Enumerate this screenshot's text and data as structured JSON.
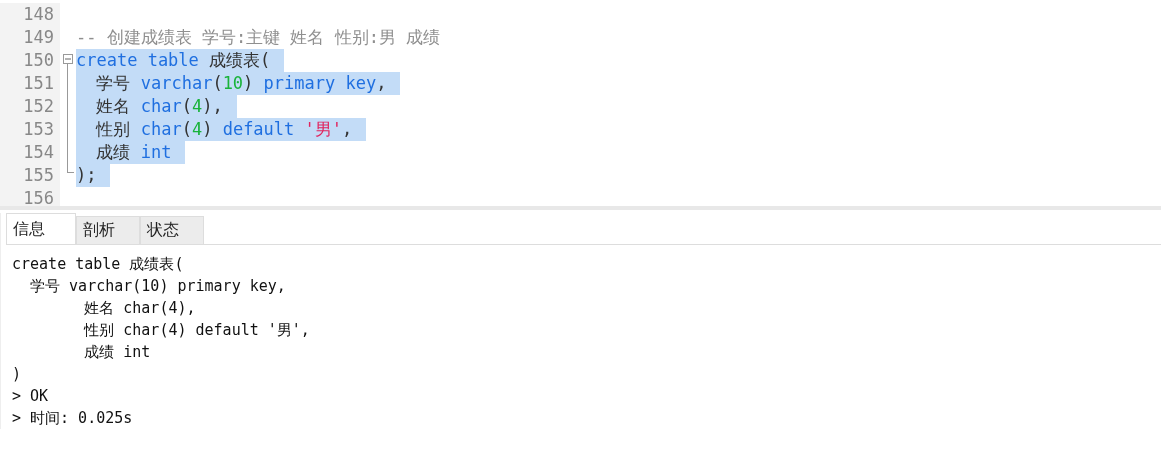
{
  "editor": {
    "lines": [
      {
        "number": "148",
        "selected": false,
        "kind": "plain"
      },
      {
        "number": "149",
        "selected": false,
        "kind": "plain",
        "tokens": [
          {
            "kind": "comment",
            "text": "-- 创建成绩表 学号:主键 姓名 性别:男 成绩"
          }
        ]
      },
      {
        "number": "150",
        "selected": true,
        "kind": "open",
        "tokens": [
          {
            "kind": "keyword",
            "text": "create table"
          },
          {
            "kind": "plain",
            "text": " 成绩表("
          }
        ]
      },
      {
        "number": "151",
        "selected": true,
        "kind": "inner",
        "tokens": [
          {
            "kind": "plain",
            "text": "  学号 "
          },
          {
            "kind": "keyword",
            "text": "varchar"
          },
          {
            "kind": "plain",
            "text": "("
          },
          {
            "kind": "number",
            "text": "10"
          },
          {
            "kind": "plain",
            "text": ") "
          },
          {
            "kind": "keyword",
            "text": "primary key"
          },
          {
            "kind": "plain",
            "text": ","
          }
        ]
      },
      {
        "number": "152",
        "selected": true,
        "kind": "inner",
        "tokens": [
          {
            "kind": "plain",
            "text": "  姓名 "
          },
          {
            "kind": "keyword",
            "text": "char"
          },
          {
            "kind": "plain",
            "text": "("
          },
          {
            "kind": "number",
            "text": "4"
          },
          {
            "kind": "plain",
            "text": "),"
          }
        ]
      },
      {
        "number": "153",
        "selected": true,
        "kind": "inner",
        "tokens": [
          {
            "kind": "plain",
            "text": "  性别 "
          },
          {
            "kind": "keyword",
            "text": "char"
          },
          {
            "kind": "plain",
            "text": "("
          },
          {
            "kind": "number",
            "text": "4"
          },
          {
            "kind": "plain",
            "text": ") "
          },
          {
            "kind": "keyword",
            "text": "default "
          },
          {
            "kind": "string",
            "text": "'男'"
          },
          {
            "kind": "plain",
            "text": ","
          }
        ]
      },
      {
        "number": "154",
        "selected": true,
        "kind": "inner",
        "tokens": [
          {
            "kind": "plain",
            "text": "  成绩 "
          },
          {
            "kind": "keyword",
            "text": "int"
          }
        ]
      },
      {
        "number": "155",
        "selected": true,
        "kind": "close",
        "tokens": [
          {
            "kind": "plain",
            "text": ");"
          }
        ]
      },
      {
        "number": "156",
        "selected": false,
        "kind": "plain"
      }
    ]
  },
  "result_tabs": [
    {
      "label": "信息",
      "selected": true
    },
    {
      "label": "剖析",
      "selected": false
    },
    {
      "label": "状态",
      "selected": false
    }
  ],
  "message_lines": [
    "create table 成绩表(",
    "  学号 varchar(10) primary key,",
    "        姓名 char(4),",
    "        性别 char(4) default '男',",
    "        成绩 int",
    ")",
    "> OK",
    "> 时间: 0.025s"
  ]
}
